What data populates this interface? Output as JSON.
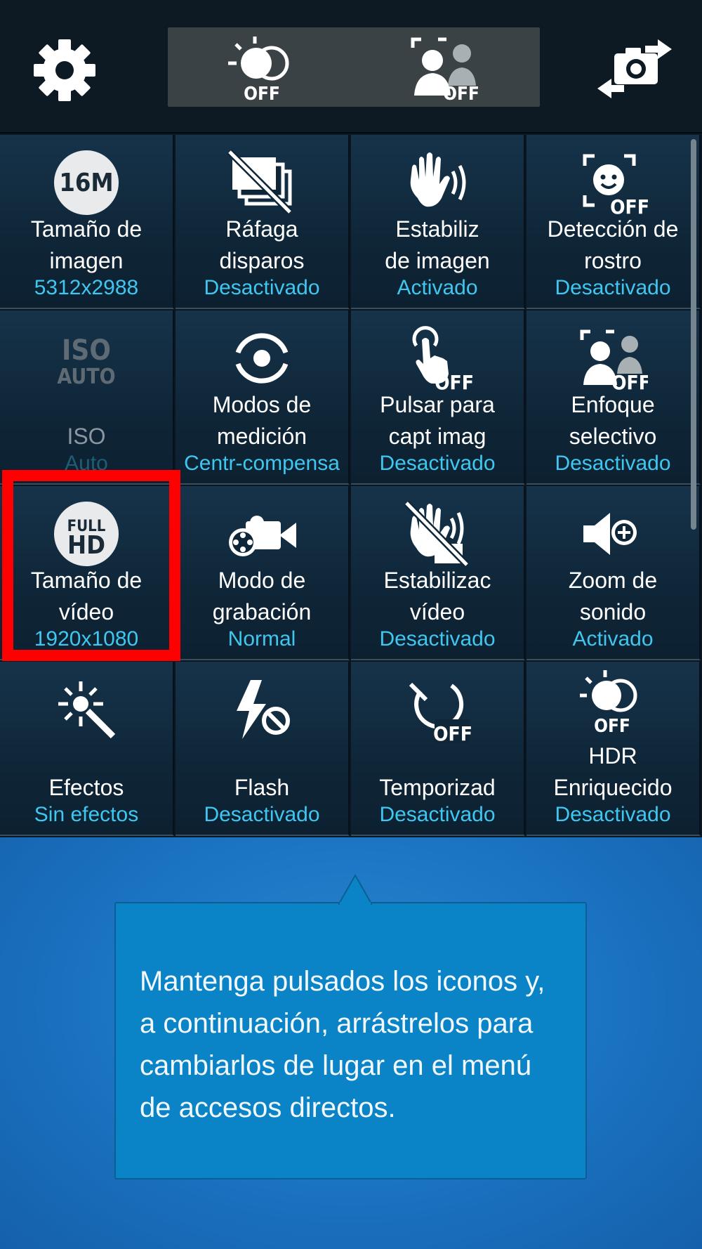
{
  "topbar": {
    "hdr_off_label": "OFF",
    "selective_focus_off_label": "OFF"
  },
  "settings": [
    {
      "label_line1": "Tamaño de",
      "label_line2": "imagen",
      "value": "5312x2988",
      "icon": "image-size-16m-icon",
      "icon_text": "16M"
    },
    {
      "label_line1": "Ráfaga",
      "label_line2": "disparos",
      "value": "Desactivado",
      "icon": "burst-shot-off-icon"
    },
    {
      "label_line1": "Estabiliz",
      "label_line2": "de imagen",
      "value": "Activado",
      "icon": "image-stabilization-icon"
    },
    {
      "label_line1": "Detección de",
      "label_line2": "rostro",
      "value": "Desactivado",
      "icon": "face-detection-off-icon",
      "icon_text": "OFF"
    },
    {
      "label_line1": "",
      "label_line2": "ISO",
      "value": "Auto",
      "icon": "iso-auto-icon",
      "icon_text": "ISO",
      "icon_text2": "AUTO",
      "disabled": true
    },
    {
      "label_line1": "Modos de",
      "label_line2": "medición",
      "value": "Centr-compensa",
      "icon": "metering-modes-icon"
    },
    {
      "label_line1": "Pulsar para",
      "label_line2": "capt imag",
      "value": "Desactivado",
      "icon": "tap-to-capture-off-icon",
      "icon_text": "OFF"
    },
    {
      "label_line1": "Enfoque",
      "label_line2": "selectivo",
      "value": "Desactivado",
      "icon": "selective-focus-off-icon",
      "icon_text": "OFF"
    },
    {
      "label_line1": "Tamaño de",
      "label_line2": "vídeo",
      "value": "1920x1080",
      "icon": "full-hd-icon",
      "icon_text": "FULL",
      "icon_text2": "HD"
    },
    {
      "label_line1": "Modo de",
      "label_line2": "grabación",
      "value": "Normal",
      "icon": "recording-mode-icon"
    },
    {
      "label_line1": "Estabilizac",
      "label_line2": "vídeo",
      "value": "Desactivado",
      "icon": "video-stabilization-off-icon"
    },
    {
      "label_line1": "Zoom de",
      "label_line2": "sonido",
      "value": "Activado",
      "icon": "audio-zoom-icon"
    },
    {
      "label_line1": "",
      "label_line2": "Efectos",
      "value": "Sin efectos",
      "icon": "effects-wand-icon"
    },
    {
      "label_line1": "",
      "label_line2": "Flash",
      "value": "Desactivado",
      "icon": "flash-off-icon"
    },
    {
      "label_line1": "",
      "label_line2": "Temporizad",
      "value": "Desactivado",
      "icon": "timer-off-icon",
      "icon_text": "OFF"
    },
    {
      "label_line1": "HDR",
      "label_line2": "Enriquecido",
      "value": "Desactivado",
      "icon": "rich-hdr-off-icon",
      "icon_text": "OFF"
    }
  ],
  "help": {
    "text": "Mantenga pulsados los iconos y, a continuación, arrástrelos para cambiarlos de lugar en el menú de accesos directos."
  },
  "colors": {
    "value_text": "#3fc7f0",
    "highlight": "#ff0000",
    "help_background": "#1a72c0",
    "bubble": "#0a84c6"
  }
}
